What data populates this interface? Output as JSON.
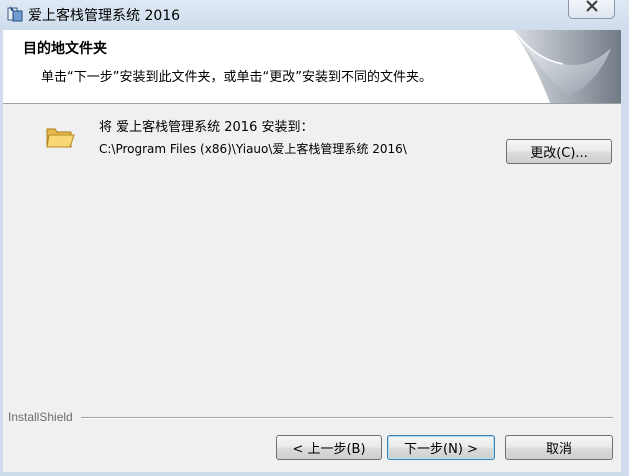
{
  "window": {
    "title": "爱上客栈管理系统 2016",
    "app_icon": "installer-icon",
    "close_icon": "close-icon"
  },
  "header": {
    "heading": "目的地文件夹",
    "description": "单击“下一步”安装到此文件夹，或单击“更改”安装到不同的文件夹。"
  },
  "destination": {
    "folder_icon": "folder-icon",
    "install_to_label": "将 爱上客栈管理系统 2016 安装到：",
    "path": "C:\\Program Files (x86)\\Yiauo\\爱上客栈管理系统 2016\\",
    "change_button": "更改(C)..."
  },
  "footer": {
    "brand_label": "InstallShield",
    "back_button": "< 上一步(B)",
    "next_button": "下一步(N) >",
    "cancel_button": "取消"
  },
  "colors": {
    "accent_focus": "#3c7fb1",
    "titlebar": "#cfdcec",
    "dialog_bg": "#f0f0f0"
  }
}
